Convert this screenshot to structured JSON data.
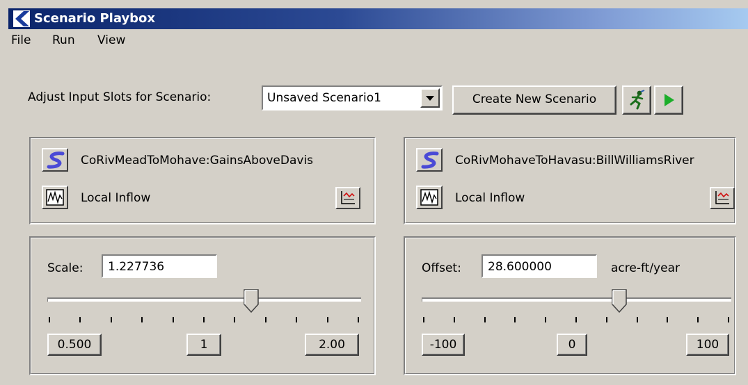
{
  "window": {
    "title": "Scenario Playbox"
  },
  "menu": [
    "File",
    "Run",
    "View"
  ],
  "toolbar": {
    "prompt": "Adjust Input Slots for Scenario:",
    "scenario_value": "Unsaved Scenario1",
    "create_button": "Create New Scenario"
  },
  "panels": [
    {
      "slot": "CoRivMeadToMohave:GainsAboveDavis",
      "slot_type": "Local Inflow",
      "param_label": "Scale:",
      "param_value": "1.227736",
      "unit": "",
      "slider_position": 0.65,
      "buttons": [
        "0.500",
        "1",
        "2.00"
      ]
    },
    {
      "slot": "CoRivMohaveToHavasu:BillWilliamsRiver",
      "slot_type": "Local Inflow",
      "param_label": "Offset:",
      "param_value": "28.600000",
      "unit": "acre-ft/year",
      "slider_position": 0.64,
      "buttons": [
        "-100",
        "0",
        "100"
      ]
    }
  ],
  "colors": {
    "title_start": "#0a246a",
    "title_end": "#a6caf0",
    "window_bg": "#d4d0c8"
  }
}
